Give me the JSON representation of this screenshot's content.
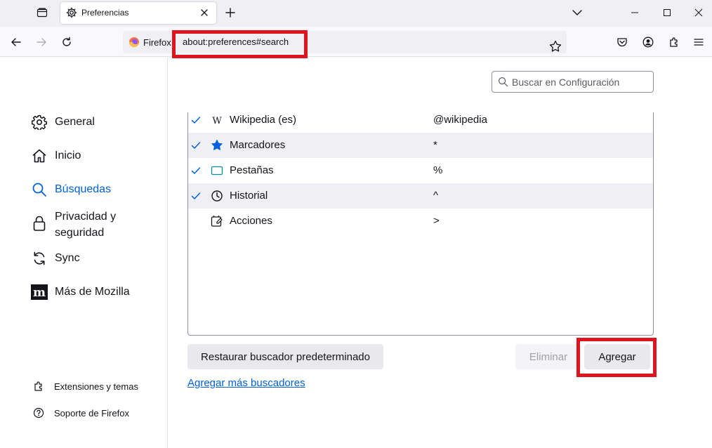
{
  "browser": {
    "tab_title": "Preferencias",
    "identity_label": "Firefox",
    "url": "about:preferences#search",
    "highlight_color": "#e0141e",
    "accent_color": "#0061e0"
  },
  "search": {
    "placeholder": "Buscar en Configuración"
  },
  "sidebar": {
    "items": [
      {
        "label": "General",
        "icon": "gear-icon"
      },
      {
        "label": "Inicio",
        "icon": "home-icon"
      },
      {
        "label": "Búsquedas",
        "icon": "search-icon",
        "active": true
      },
      {
        "label": "Privacidad y seguridad",
        "icon": "lock-icon"
      },
      {
        "label": "Sync",
        "icon": "sync-icon"
      },
      {
        "label": "Más de Mozilla",
        "icon": "mozilla-icon"
      }
    ],
    "footer": [
      {
        "label": "Extensiones y temas",
        "icon": "puzzle-icon"
      },
      {
        "label": "Soporte de Firefox",
        "icon": "help-icon"
      }
    ]
  },
  "engines": [
    {
      "name": "Wikipedia (es)",
      "keyword": "@wikipedia",
      "checked": true,
      "icon": "wikipedia-icon"
    },
    {
      "name": "Marcadores",
      "keyword": "*",
      "checked": true,
      "icon": "star-icon"
    },
    {
      "name": "Pestañas",
      "keyword": "%",
      "checked": true,
      "icon": "tab-icon"
    },
    {
      "name": "Historial",
      "keyword": "^",
      "checked": true,
      "icon": "clock-icon"
    },
    {
      "name": "Acciones",
      "keyword": ">",
      "checked": false,
      "icon": "actions-icon"
    }
  ],
  "buttons": {
    "restore_label": "Restaurar buscador predeterminado",
    "remove_label": "Eliminar",
    "add_label": "Agregar"
  },
  "links": {
    "more_engines": "Agregar más buscadores"
  }
}
